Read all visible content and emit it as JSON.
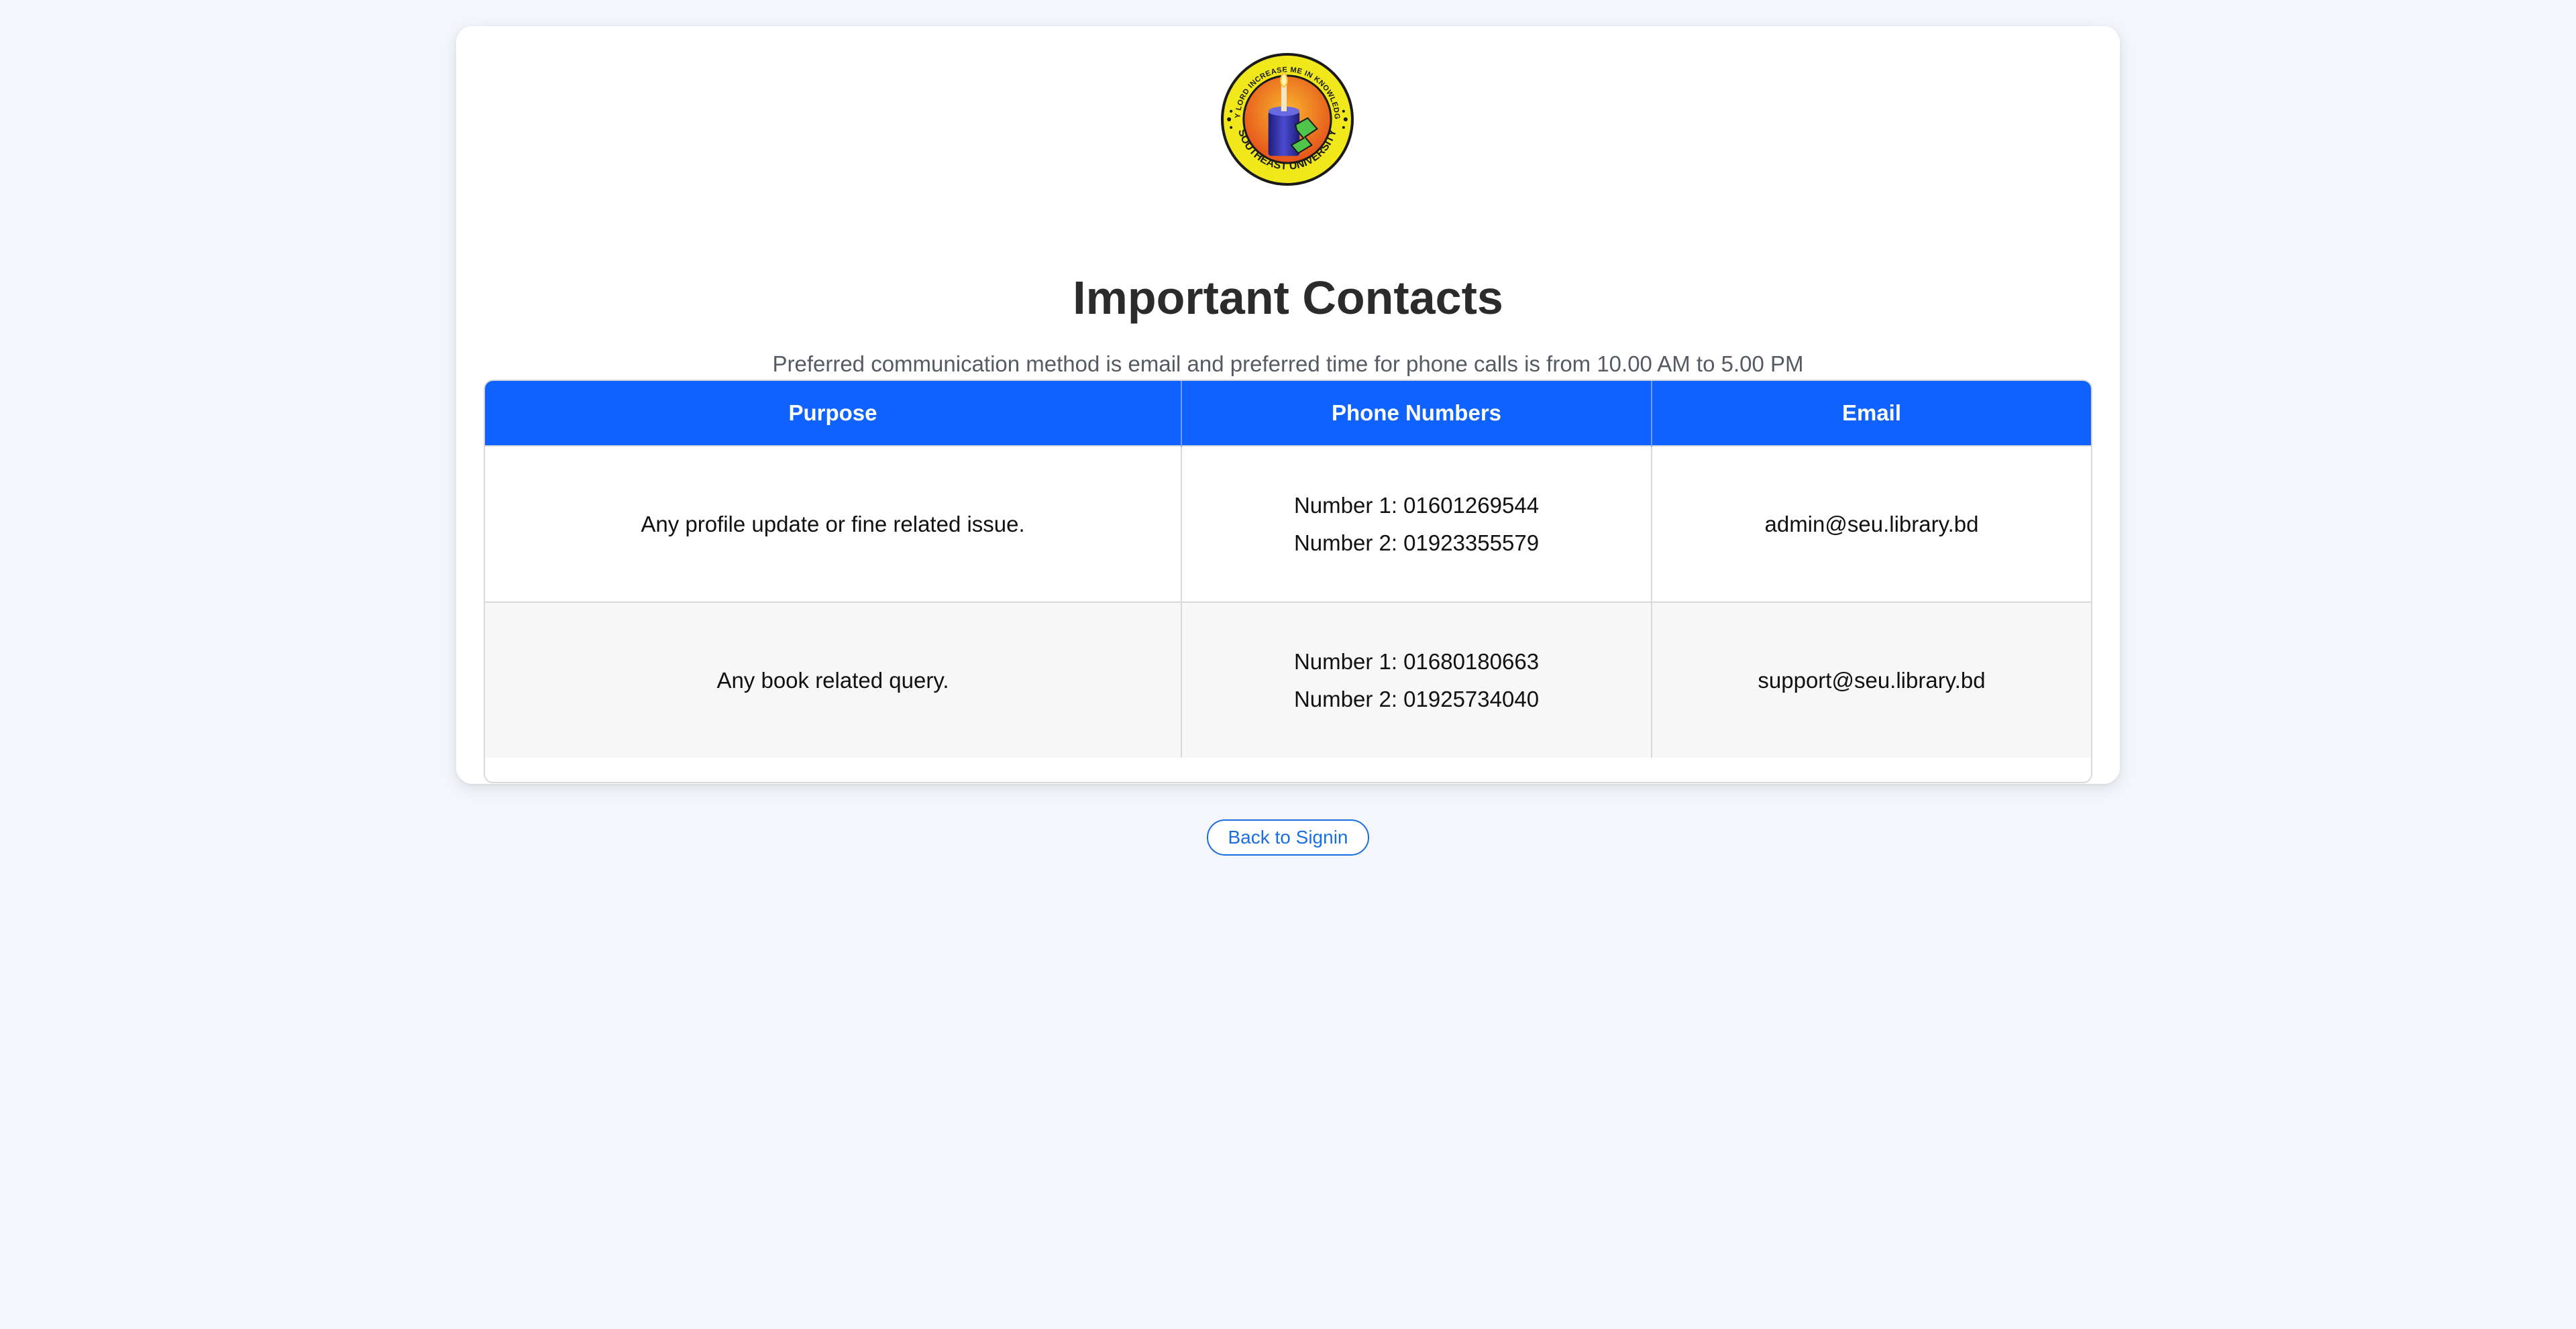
{
  "logo": {
    "name": "southeast-university-logo",
    "ring_top_text": "MY LORD INCREASE ME IN KNOWLEDGE",
    "ring_bottom_text": "SOUTHEAST UNIVERSITY",
    "colors": {
      "ring": "#f0e81a",
      "outline": "#1a1a1a",
      "center_top": "#f5a623",
      "center_bottom": "#e8621a",
      "cylinder": "#2a2a9a",
      "letter": "#4fc54a",
      "flame": "#fff3b0"
    }
  },
  "header": {
    "title": "Important Contacts",
    "subtitle": "Preferred communication method is email and preferred time for phone calls is from 10.00 AM to 5.00 PM"
  },
  "table": {
    "columns": [
      "Purpose",
      "Phone Numbers",
      "Email"
    ],
    "rows": [
      {
        "purpose": "Any profile update or fine related issue.",
        "phones": [
          "Number 1: 01601269544",
          "Number 2: 01923355579"
        ],
        "email": "admin@seu.library.bd"
      },
      {
        "purpose": "Any book related query.",
        "phones": [
          "Number 1: 01680180663",
          "Number 2: 01925734040"
        ],
        "email": "support@seu.library.bd"
      }
    ]
  },
  "actions": {
    "back_label": "Back to Signin"
  },
  "colors": {
    "page_background": "#f3f7fb",
    "card_background": "#ffffff",
    "header_blue": "#0f62fe",
    "link_blue": "#1a6fe0",
    "alt_row": "#f7f7f7"
  }
}
